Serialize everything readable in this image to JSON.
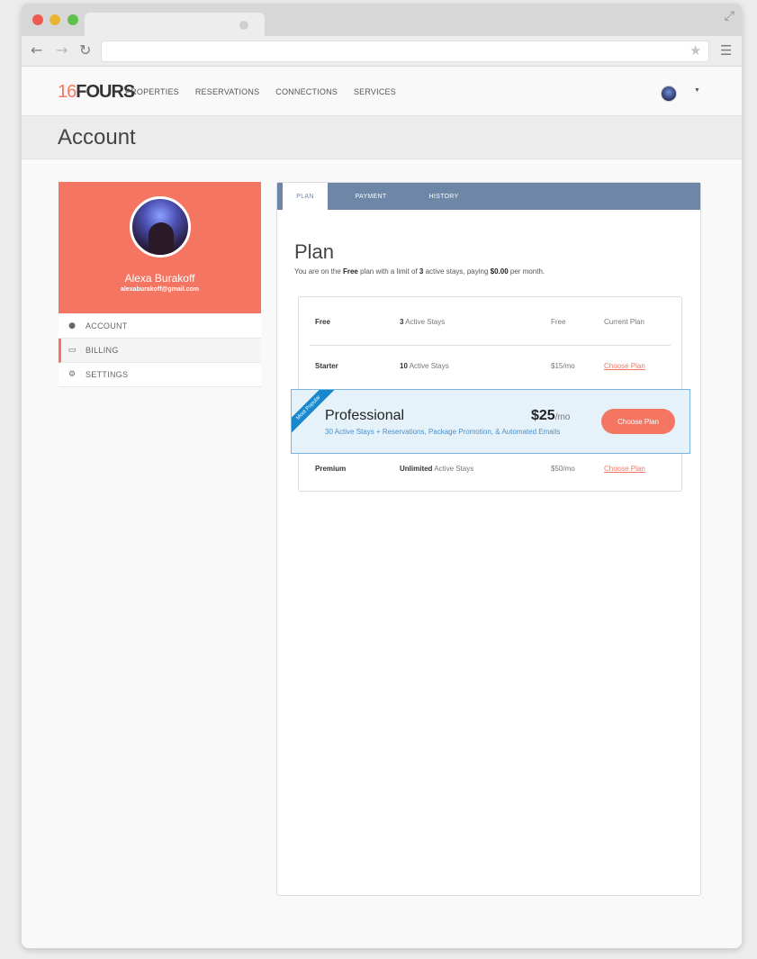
{
  "browser": {
    "url": ""
  },
  "header": {
    "logo_num": "16",
    "logo_text": "FOURS",
    "nav": [
      "PROPERTIES",
      "RESERVATIONS",
      "CONNECTIONS",
      "SERVICES"
    ]
  },
  "page": {
    "title": "Account"
  },
  "profile": {
    "name": "Alexa Burakoff",
    "email": "alexaburakoff@gmail.com"
  },
  "sidebar": {
    "items": [
      {
        "label": "ACCOUNT",
        "icon": "user-icon"
      },
      {
        "label": "BILLING",
        "icon": "credit-card-icon",
        "active": true
      },
      {
        "label": "SETTINGS",
        "icon": "gear-icon"
      }
    ]
  },
  "tabs": [
    "PLAN",
    "PAYMENT",
    "HISTORY"
  ],
  "plan": {
    "title": "Plan",
    "desc_prefix": "You are on the ",
    "current_plan": "Free",
    "desc_mid": " plan with a limit of ",
    "limit": "3",
    "desc_mid2": " active stays, paying ",
    "amount": "$0.00",
    "desc_suffix": " per month."
  },
  "plans": [
    {
      "name": "Free",
      "stays_num": "3",
      "stays_text": " Active Stays",
      "price": "Free",
      "action": "Current Plan"
    },
    {
      "name": "Starter",
      "stays_num": "10",
      "stays_text": " Active Stays",
      "price": "$15/mo",
      "action": "Choose Plan"
    },
    {
      "name": "Premium",
      "stays_num": "Unlimited",
      "stays_text": " Active Stays",
      "price": "$50/mo",
      "action": "Choose Plan"
    }
  ],
  "featured": {
    "ribbon": "Most Popular",
    "name": "Professional",
    "price": "$25",
    "unit": "/mo",
    "description": "30 Active Stays + Reservations, Package Promotion, & Automated Emails",
    "button": "Choose Plan"
  },
  "colors": {
    "accent": "#f47562",
    "tab_bar": "#6e87a6",
    "featured_bg": "#e6f2fa",
    "ribbon": "#1a88cc"
  }
}
